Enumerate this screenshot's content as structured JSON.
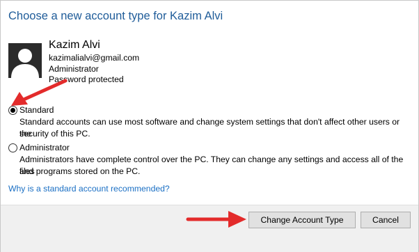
{
  "dialog": {
    "title": "Choose a new account type for Kazim Alvi"
  },
  "user": {
    "avatar_icon": "user-avatar-icon",
    "name": "Kazim Alvi",
    "email": "kazimalialvi@gmail.com",
    "account_type": "Administrator",
    "password_status": "Password protected"
  },
  "options": [
    {
      "label": "Standard",
      "selected": true,
      "description_line1": "Standard accounts can use most software and change system settings that don't affect other users or the",
      "description_line2": "security of this PC."
    },
    {
      "label": "Administrator",
      "selected": false,
      "description_line1": "Administrators have complete control over the PC. They can change any settings and access all of the files",
      "description_line2": "and programs stored on the PC."
    }
  ],
  "help_link": "Why is a standard account recommended?",
  "buttons": {
    "change": "Change Account Type",
    "cancel": "Cancel"
  },
  "annotations": {
    "arrow_color": "#e32b2b",
    "arrows": [
      "arrow-to-standard-radio",
      "arrow-to-change-button"
    ]
  }
}
